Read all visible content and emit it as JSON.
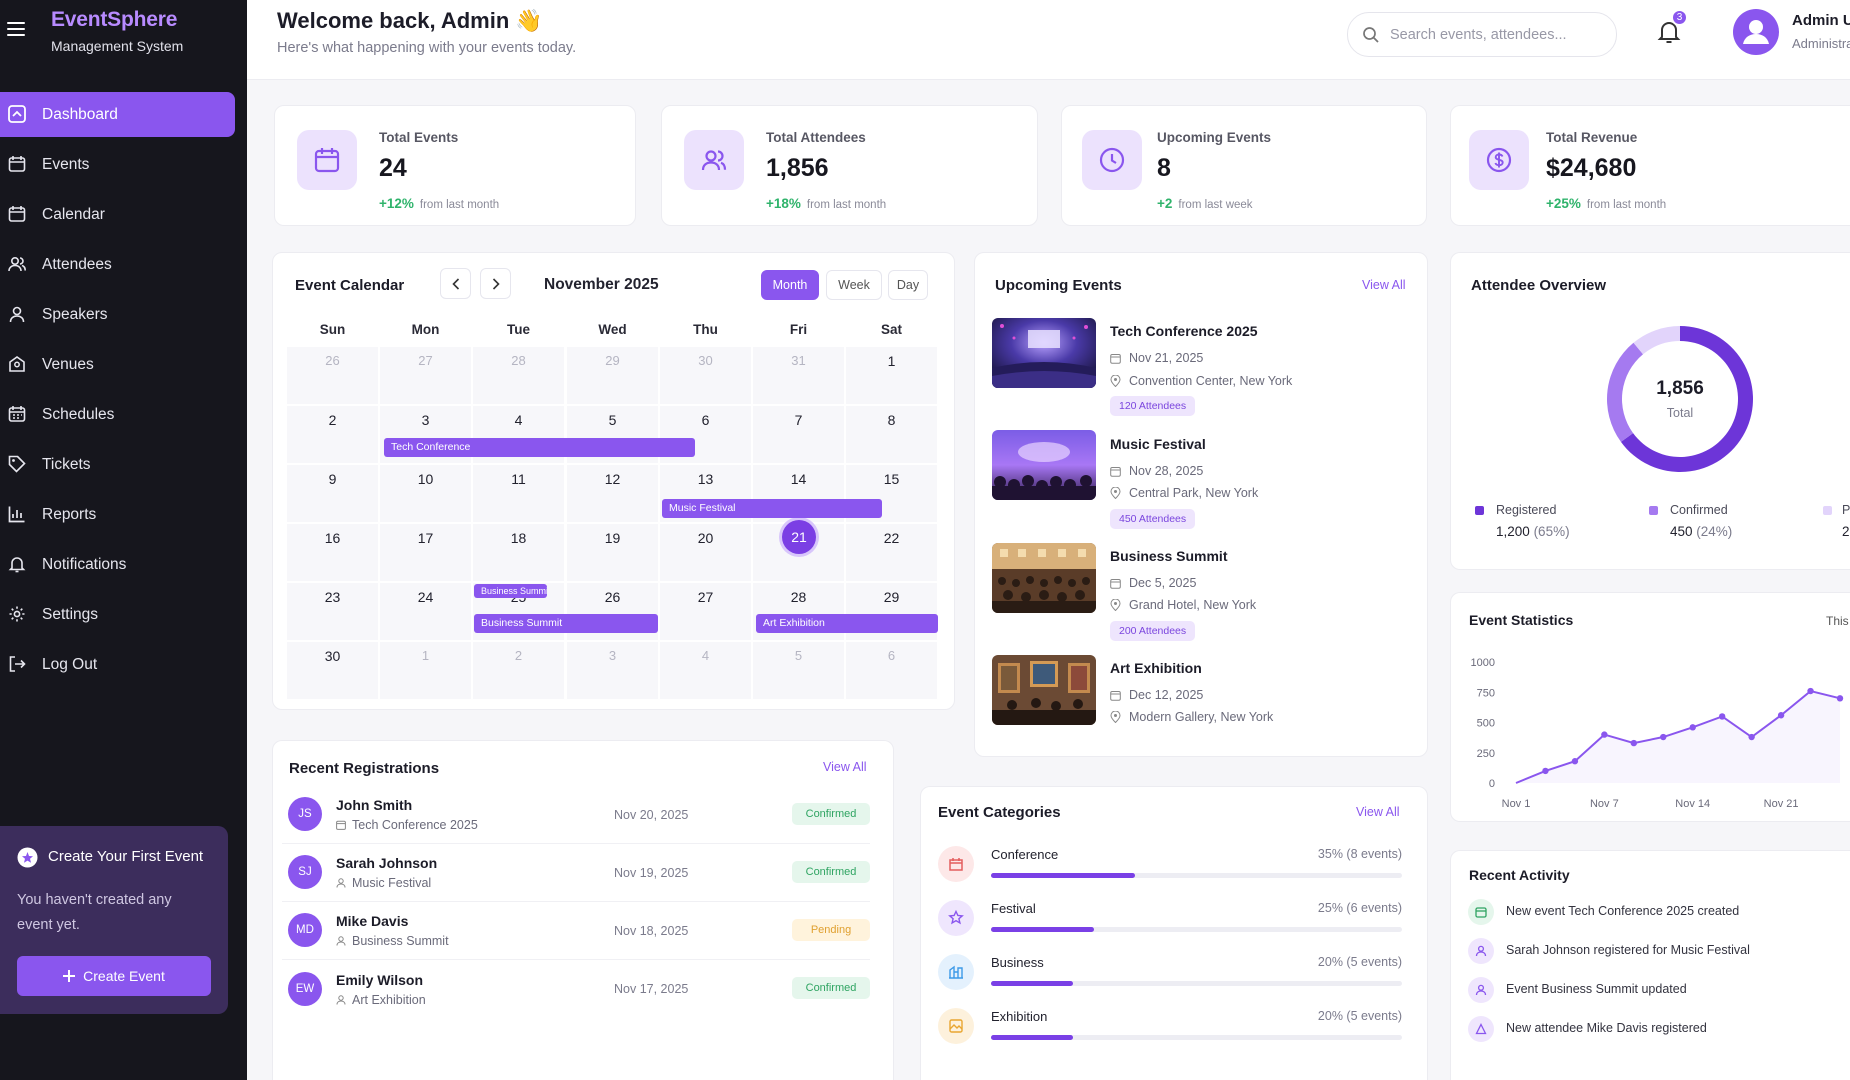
{
  "app": {
    "title": "EventSphere",
    "subtitle": "Management System"
  },
  "sidebar": {
    "items": [
      {
        "label": "Dashboard",
        "icon": "dashboard-icon"
      },
      {
        "label": "Events",
        "icon": "events-icon"
      },
      {
        "label": "Calendar",
        "icon": "calendar-icon"
      },
      {
        "label": "Attendees",
        "icon": "attendees-icon"
      },
      {
        "label": "Speakers",
        "icon": "speaker-icon"
      },
      {
        "label": "Venues",
        "icon": "venue-icon"
      },
      {
        "label": "Schedules",
        "icon": "schedule-icon"
      },
      {
        "label": "Tickets",
        "icon": "ticket-icon"
      },
      {
        "label": "Reports",
        "icon": "reports-icon"
      },
      {
        "label": "Notifications",
        "icon": "bell-icon"
      },
      {
        "label": "Settings",
        "icon": "gear-icon"
      },
      {
        "label": "Log Out",
        "icon": "logout-icon"
      }
    ],
    "promo": {
      "title": "Create Your First Event",
      "text": "You haven't created any event yet.",
      "button": "Create Event"
    }
  },
  "header": {
    "welcome": "Welcome back, Admin 👋",
    "subtitle": "Here's what happening with your events today.",
    "search_placeholder": "Search events, attendees...",
    "notification_count": "3",
    "user_name": "Admin User",
    "user_role": "Administrator"
  },
  "stats": [
    {
      "label": "Total Events",
      "value": "24",
      "change": "+12%",
      "change_sub": "from last month",
      "icon": "calendar-icon"
    },
    {
      "label": "Total Attendees",
      "value": "1,856",
      "change": "+18%",
      "change_sub": "from last month",
      "icon": "users-icon"
    },
    {
      "label": "Upcoming Events",
      "value": "8",
      "change": "+2",
      "change_sub": "from last week",
      "icon": "clock-icon"
    },
    {
      "label": "Total Revenue",
      "value": "$24,680",
      "change": "+25%",
      "change_sub": "from last month",
      "icon": "dollar-icon"
    }
  ],
  "calendar": {
    "title": "Event Calendar",
    "month": "November 2025",
    "views": [
      "Month",
      "Week",
      "Day"
    ],
    "weekdays": [
      "Sun",
      "Mon",
      "Tue",
      "Wed",
      "Thu",
      "Fri",
      "Sat"
    ],
    "weeks": [
      [
        "26",
        "27",
        "28",
        "29",
        "30",
        "31",
        "1"
      ],
      [
        "2",
        "3",
        "4",
        "5",
        "6",
        "7",
        "8"
      ],
      [
        "9",
        "10",
        "11",
        "12",
        "13",
        "14",
        "15"
      ],
      [
        "16",
        "17",
        "18",
        "19",
        "20",
        "21",
        "22"
      ],
      [
        "23",
        "24",
        "25",
        "26",
        "27",
        "28",
        "29"
      ],
      [
        "30",
        "1",
        "2",
        "3",
        "4",
        "5",
        "6"
      ]
    ],
    "events": {
      "tech": "Tech Conference",
      "music": "Music Festival",
      "business_small": "Business Summit",
      "business": "Business Summit",
      "art": "Art Exhibition"
    }
  },
  "upcoming": {
    "title": "Upcoming Events",
    "view_all": "View All",
    "items": [
      {
        "name": "Tech Conference 2025",
        "date": "Nov 21, 2025",
        "venue": "Convention Center, New York",
        "attendees": "120 Attendees"
      },
      {
        "name": "Music Festival",
        "date": "Nov 28, 2025",
        "venue": "Central Park, New York",
        "attendees": "450 Attendees"
      },
      {
        "name": "Business Summit",
        "date": "Dec 5, 2025",
        "venue": "Grand Hotel, New York",
        "attendees": "200 Attendees"
      },
      {
        "name": "Art Exhibition",
        "date": "Dec 12, 2025",
        "venue": "Modern Gallery, New York",
        "attendees": ""
      }
    ]
  },
  "overview": {
    "title": "Attendee Overview",
    "total": "1,856",
    "total_label": "Total",
    "legend": [
      {
        "label": "Registered",
        "value": "1,200",
        "pct": "(65%)",
        "share": 0.65,
        "color": "#6d35d8"
      },
      {
        "label": "Confirmed",
        "value": "450",
        "pct": "(24%)",
        "share": 0.24,
        "color": "#a57af0"
      },
      {
        "label": "P",
        "value": "2",
        "pct": "",
        "share": 0.11,
        "color": "#e2d4fb"
      }
    ]
  },
  "statistics": {
    "title": "Event Statistics",
    "period": "This",
    "chart_data": {
      "type": "line",
      "x": [
        "Nov 1",
        "",
        "",
        "",
        "Nov 7",
        "",
        "",
        "",
        "",
        "",
        "Nov 14",
        "",
        "",
        "",
        "Nov 21",
        ""
      ],
      "xticks": [
        "Nov 1",
        "Nov 7",
        "Nov 14",
        "Nov 21"
      ],
      "values": [
        0,
        100,
        180,
        400,
        330,
        380,
        460,
        550,
        380,
        560,
        760,
        700
      ],
      "yticks": [
        "1000",
        "750",
        "500",
        "250",
        "0"
      ],
      "ylim": [
        0,
        1000
      ],
      "color": "#8a56ee"
    }
  },
  "registrations": {
    "title": "Recent Registrations",
    "view_all": "View All",
    "items": [
      {
        "initials": "JS",
        "name": "John Smith",
        "event": "Tech Conference 2025",
        "date": "Nov 20, 2025",
        "status": "Confirmed"
      },
      {
        "initials": "SJ",
        "name": "Sarah Johnson",
        "event": "Music Festival",
        "date": "Nov 19, 2025",
        "status": "Confirmed"
      },
      {
        "initials": "MD",
        "name": "Mike Davis",
        "event": "Business Summit",
        "date": "Nov 18, 2025",
        "status": "Pending"
      },
      {
        "initials": "EW",
        "name": "Emily Wilson",
        "event": "Art Exhibition",
        "date": "Nov 17, 2025",
        "status": "Confirmed"
      }
    ]
  },
  "categories": {
    "title": "Event Categories",
    "view_all": "View All",
    "items": [
      {
        "name": "Conference",
        "pct": "35% (8 events)",
        "share": 0.35,
        "color": "#e35d5d",
        "bg": "#fde8e8"
      },
      {
        "name": "Festival",
        "pct": "25% (6 events)",
        "share": 0.25,
        "color": "#8a56ee",
        "bg": "#efe6fd"
      },
      {
        "name": "Business",
        "pct": "20% (5 events)",
        "share": 0.2,
        "color": "#3d9ae8",
        "bg": "#e4f1fd"
      },
      {
        "name": "Exhibition",
        "pct": "20% (5 events)",
        "share": 0.2,
        "color": "#e9a630",
        "bg": "#fdf1dc"
      }
    ]
  },
  "activity": {
    "title": "Recent Activity",
    "items": [
      {
        "text": "New event Tech Conference 2025 created",
        "color": "#2fa462",
        "bg": "#e5f6ec"
      },
      {
        "text": "Sarah Johnson registered for Music Festival",
        "color": "#8a56ee",
        "bg": "#efe6fd"
      },
      {
        "text": "Event Business Summit updated",
        "color": "#8a56ee",
        "bg": "#efe6fd"
      },
      {
        "text": "New attendee Mike Davis registered",
        "color": "#8a56ee",
        "bg": "#efe6fd"
      }
    ]
  }
}
